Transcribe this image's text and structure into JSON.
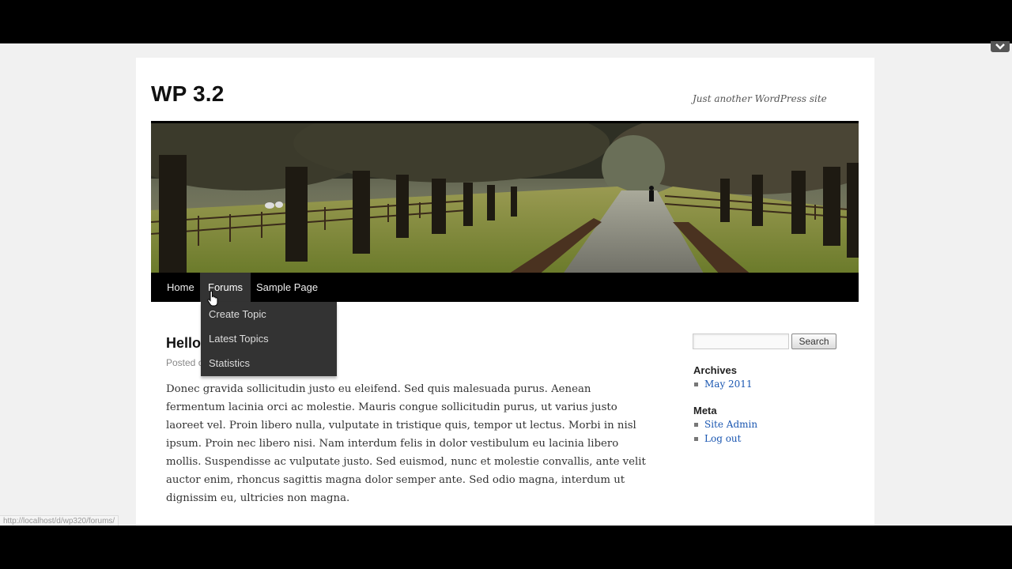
{
  "site": {
    "title": "WP 3.2",
    "description": "Just another WordPress site"
  },
  "nav": {
    "items": [
      {
        "label": "Home"
      },
      {
        "label": "Forums",
        "active": true
      },
      {
        "label": "Sample Page"
      }
    ],
    "dropdown": [
      {
        "label": "Create Topic"
      },
      {
        "label": "Latest Topics"
      },
      {
        "label": "Statistics"
      }
    ]
  },
  "post": {
    "title": "Hello",
    "meta": "Posted o",
    "body": "Donec gravida sollicitudin justo eu eleifend. Sed quis malesuada purus. Aenean fermentum lacinia orci ac molestie. Mauris congue sollicitudin purus, ut varius justo laoreet vel. Proin libero nulla, vulputate in tristique quis, tempor ut lectus. Morbi in nisl ipsum. Proin nec libero nisi. Nam interdum felis in dolor vestibulum eu lacinia libero mollis. Suspendisse ac vulputate justo. Sed euismod, nunc et molestie convallis, ante velit auctor enim, rhoncus sagittis magna dolor semper ante. Sed odio magna, interdum ut dignissim eu, ultricies non magna."
  },
  "sidebar": {
    "search": {
      "value": "",
      "button_label": "Search"
    },
    "archives": {
      "title": "Archives",
      "items": [
        {
          "label": "May 2011"
        }
      ]
    },
    "meta": {
      "title": "Meta",
      "items": [
        {
          "label": "Site Admin"
        },
        {
          "label": "Log out"
        }
      ]
    }
  },
  "status_bar": {
    "url": "http://localhost/d/wp320/forums/"
  },
  "colors": {
    "link": "#1b57b1",
    "nav_bg": "#000000",
    "dropdown_bg": "#333333"
  },
  "icons": {
    "cursor": "hand-pointer-icon",
    "corner": "chevron-down-icon"
  }
}
